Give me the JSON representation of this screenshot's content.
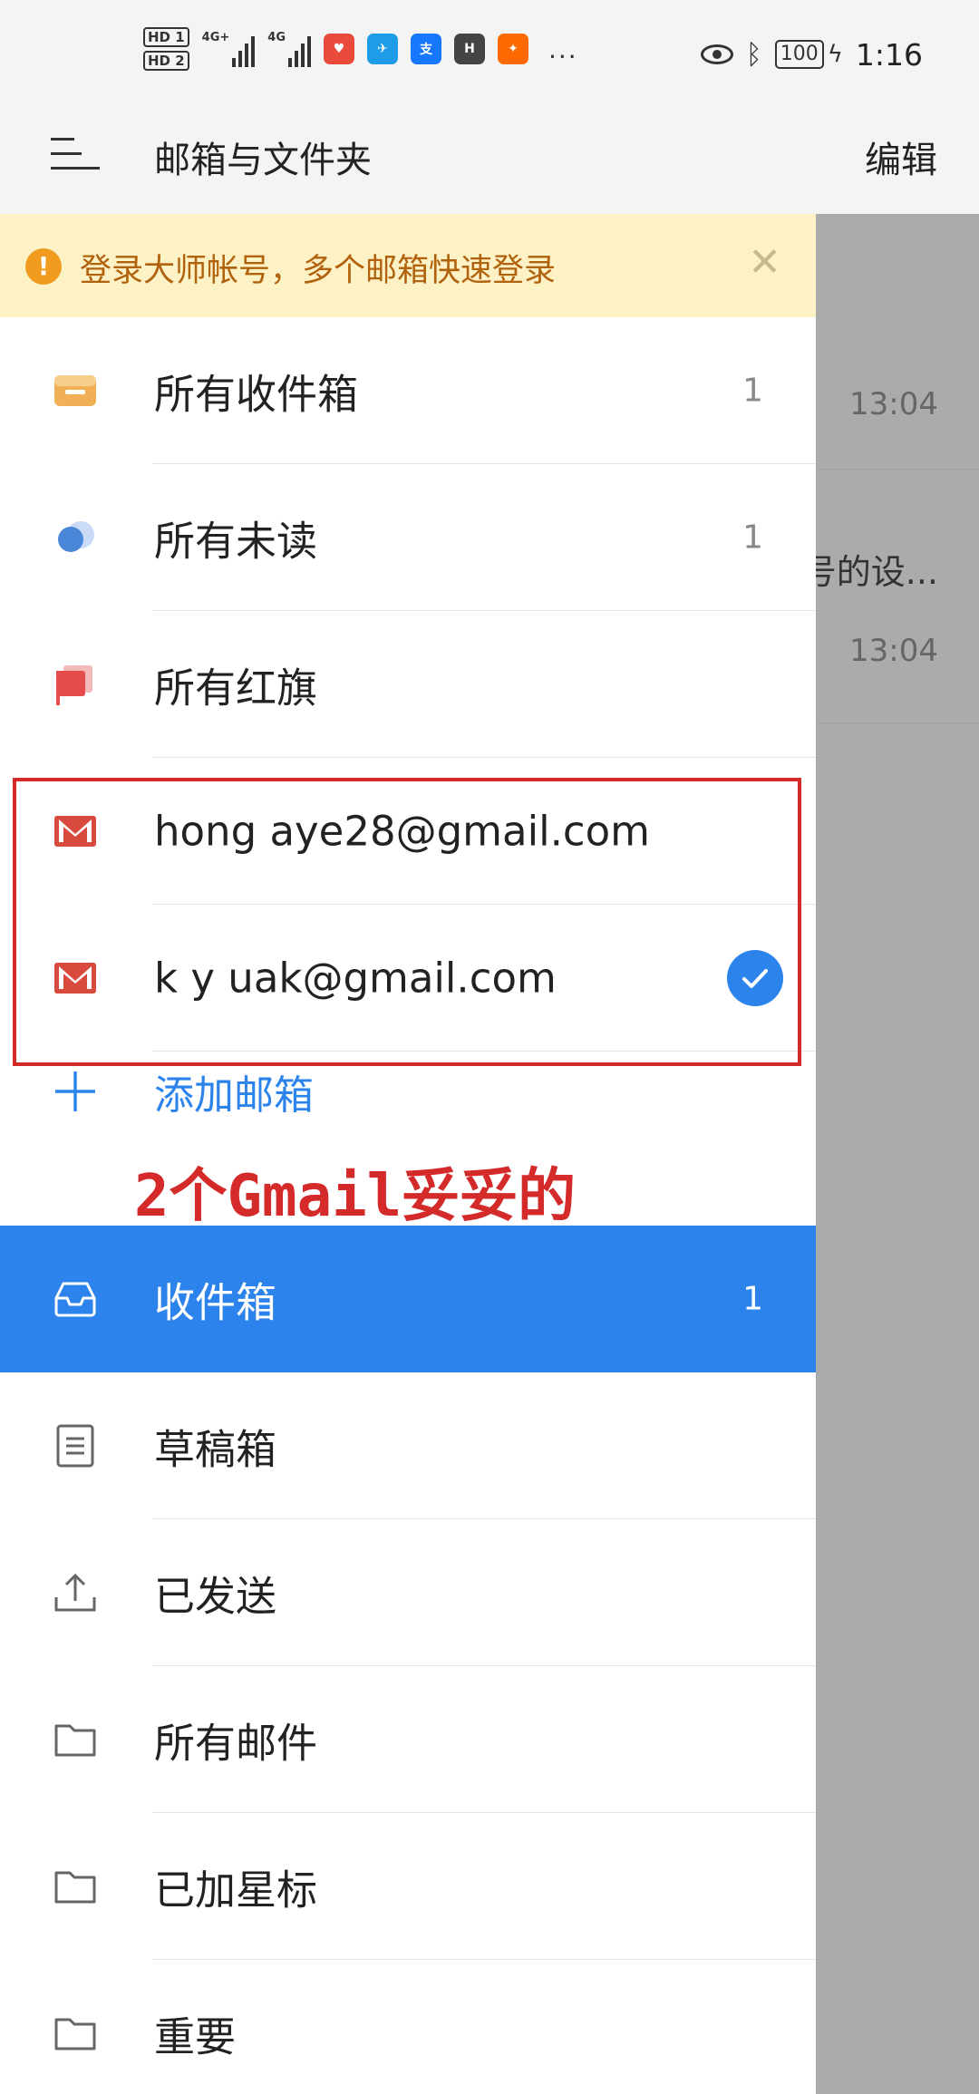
{
  "status_bar": {
    "hd1": "HD 1",
    "hd2": "HD 2",
    "signal1": "4G+",
    "signal2": "4G",
    "more": "...",
    "battery": "100",
    "time": "1:16"
  },
  "toolbar": {
    "title": "邮箱与文件夹",
    "edit": "编辑"
  },
  "banner": {
    "text": "登录大师帐号，多个邮箱快速登录",
    "icon": "info-icon"
  },
  "accounts_section": [
    {
      "label": "所有收件箱",
      "count": "1",
      "icon": "inbox-tray-icon"
    },
    {
      "label": "所有未读",
      "count": "1",
      "icon": "unread-dot-icon"
    },
    {
      "label": "所有红旗",
      "count": "",
      "icon": "red-flag-icon"
    }
  ],
  "mail_accounts": [
    {
      "email": "hong  aye28@gmail.com",
      "selected": false
    },
    {
      "email": " k  y uak@gmail.com",
      "selected": true
    }
  ],
  "add_mailbox": "添加邮箱",
  "annotation": "2个Gmail妥妥的",
  "folders": [
    {
      "label": "收件箱",
      "count": "1",
      "icon": "inbox-icon",
      "selected": true
    },
    {
      "label": "草稿箱",
      "count": "",
      "icon": "draft-icon",
      "selected": false
    },
    {
      "label": "已发送",
      "count": "",
      "icon": "sent-icon",
      "selected": false
    },
    {
      "label": "所有邮件",
      "count": "",
      "icon": "folder-icon",
      "selected": false
    },
    {
      "label": "已加星标",
      "count": "",
      "icon": "folder-icon",
      "selected": false
    },
    {
      "label": "重要",
      "count": "",
      "icon": "folder-icon",
      "selected": false
    }
  ],
  "background_list": [
    {
      "time": "13:04",
      "snippet": ""
    },
    {
      "time": "13:04",
      "snippet": "号的设..."
    }
  ],
  "colors": {
    "accent": "#2c83ec",
    "banner_bg": "#fdf1c6",
    "banner_text": "#b0620c",
    "annotation": "#d42a2a"
  }
}
